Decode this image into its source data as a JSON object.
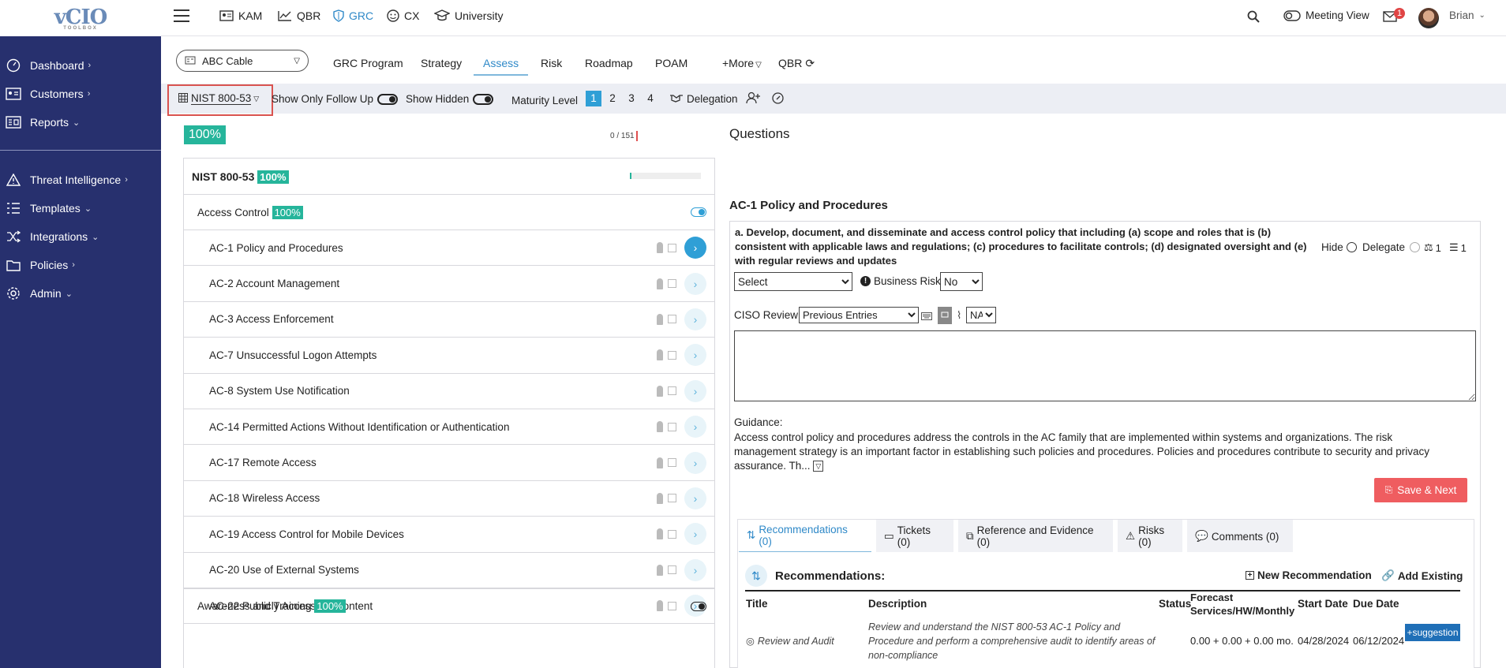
{
  "logo": {
    "text": "vCIO",
    "sub": "TOOLBOX"
  },
  "sidebar": {
    "items": [
      {
        "label": "Dashboard",
        "icon": "gauge-icon",
        "caret": "›"
      },
      {
        "label": "Customers",
        "icon": "id-card-icon",
        "caret": "›"
      },
      {
        "label": "Reports",
        "icon": "report-icon",
        "caret": "⌄"
      },
      {
        "label": "Threat Intelligence",
        "icon": "warning-icon",
        "caret": "›"
      },
      {
        "label": "Templates",
        "icon": "templates-icon",
        "caret": "⌄"
      },
      {
        "label": "Integrations",
        "icon": "shuffle-icon",
        "caret": "⌄"
      },
      {
        "label": "Policies",
        "icon": "folder-icon",
        "caret": "›"
      },
      {
        "label": "Admin",
        "icon": "gear-icon",
        "caret": "⌄"
      }
    ]
  },
  "topnav": {
    "items": [
      {
        "label": "KAM"
      },
      {
        "label": "QBR"
      },
      {
        "label": "GRC"
      },
      {
        "label": "CX"
      },
      {
        "label": "University"
      }
    ],
    "meeting_view": "Meeting View",
    "notif_count": "1",
    "user": "Brian"
  },
  "customer_select": {
    "value": "ABC Cable"
  },
  "tabs": [
    "GRC Program",
    "Strategy",
    "Assess",
    "Risk",
    "Roadmap",
    "POAM",
    "+More",
    "QBR"
  ],
  "filters": {
    "framework": "NIST 800-53",
    "follow_up": "Show Only Follow Up",
    "hidden": "Show Hidden",
    "maturity_label": "Maturity Level",
    "levels": [
      "1",
      "2",
      "3",
      "4"
    ],
    "delegation": "Delegation"
  },
  "progress": {
    "overall": "100%",
    "count": "0 / 151",
    "framework_fill": 0.02
  },
  "framework_row": {
    "label": "NIST 800-53",
    "pct": "100%"
  },
  "family": {
    "label": "Access Control",
    "pct": "100%"
  },
  "controls": [
    "AC-1 Policy and Procedures",
    "AC-2 Account Management",
    "AC-3 Access Enforcement",
    "AC-7 Unsuccessful Logon Attempts",
    "AC-8 System Use Notification",
    "AC-14 Permitted Actions Without Identification or Authentication",
    "AC-17 Remote Access",
    "AC-18 Wireless Access",
    "AC-19 Access Control for Mobile Devices",
    "AC-20 Use of External Systems",
    "AC-22 Publicly Accessible Content"
  ],
  "family2": {
    "label": "Awareness and Training",
    "pct": "100%"
  },
  "questions": {
    "heading": "Questions",
    "control_title": "AC-1 Policy and Procedures",
    "question": "a. Develop, document, and disseminate and access control policy that including (a) scope and roles that is (b) consistent with applicable laws and regulations; (c) procedures to facilitate controls; (d) designated oversight and (e) with regular reviews and updates",
    "hide": "Hide",
    "delegate": "Delegate",
    "count1": "1",
    "count2": "1",
    "answer_select": "Select",
    "business_risk_label": "Business Risk:",
    "business_risk": "No",
    "ciso_label": "CISO Review:",
    "ciso_select": "Previous Entries",
    "na": "NA",
    "guidance_label": "Guidance:",
    "guidance": "Access control policy and procedures address the controls in the AC family that are implemented within systems and organizations. The risk management strategy is an important factor in establishing such policies and procedures. Policies and procedures contribute to security and privacy assurance. Th...",
    "save_next": "Save & Next"
  },
  "rec_tabs": [
    "Recommendations (0)",
    "Tickets (0)",
    "Reference and Evidence (0)",
    "Risks (0)",
    "Comments (0)"
  ],
  "recommendations": {
    "title": "Recommendations:",
    "new": "New Recommendation",
    "add_existing": "Add Existing",
    "headers": {
      "title": "Title",
      "description": "Description",
      "status": "Status",
      "forecast": "Forecast Services/HW/Monthly",
      "start": "Start Date",
      "due": "Due Date"
    },
    "row": {
      "title": "Review and Audit",
      "description": "Review and understand the NIST 800-53 AC-1 Policy and Procedure and perform a comprehensive audit to identify areas of non-compliance",
      "forecast": "0.00 + 0.00 + 0.00 mo.",
      "start": "04/28/2024",
      "due": "06/12/2024",
      "button": "+suggestion"
    }
  }
}
